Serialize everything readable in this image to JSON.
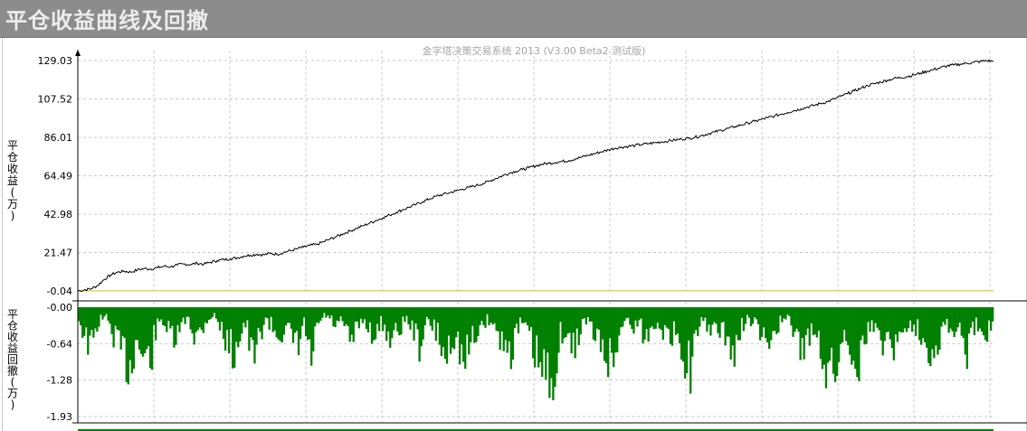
{
  "page_title": "平仓收益曲线及回撤",
  "watermark": "金字塔决策交易系统 2013 (V3.00 Beta2 测试版)",
  "colors": {
    "title_bg": "#8c8c8c",
    "equity_line": "#000000",
    "drawdown_fill": "#008000",
    "baseline": "#d4c200",
    "grid": "#c8c8c8"
  },
  "chart_data": [
    {
      "type": "line",
      "ylabel": "平仓收益(万)",
      "yticks": [
        "129.03",
        "107.52",
        "86.01",
        "64.49",
        "42.98",
        "21.47",
        "-0.04"
      ],
      "ylim": [
        -0.04,
        129.03
      ],
      "grid": true,
      "baseline": 0,
      "series": [
        {
          "values": [
            -0.04,
            0.5,
            1.2,
            3.0,
            6.5,
            9.0,
            10.5,
            11.0,
            10.5,
            11.8,
            12.5,
            12.2,
            13.0,
            13.8,
            13.5,
            14.5,
            15.0,
            14.8,
            15.5,
            15.0,
            16.0,
            17.0,
            17.5,
            18.0,
            18.5,
            19.5,
            20.0,
            20.5,
            20.2,
            21.0,
            20.5,
            21.5,
            22.5,
            23.5,
            24.5,
            25.5,
            26.0,
            27.5,
            29.0,
            30.5,
            32.0,
            33.5,
            35.0,
            36.5,
            38.0,
            39.5,
            41.0,
            42.5,
            44.0,
            45.5,
            47.0,
            48.5,
            50.0,
            51.5,
            53.0,
            54.0,
            55.0,
            56.0,
            57.0,
            58.0,
            59.0,
            60.0,
            61.5,
            63.0,
            64.5,
            66.0,
            67.0,
            68.0,
            69.0,
            70.0,
            71.0,
            71.5,
            72.0,
            72.5,
            73.0,
            74.0,
            75.0,
            76.0,
            77.0,
            78.0,
            79.0,
            80.0,
            80.5,
            81.0,
            81.5,
            82.0,
            82.5,
            83.0,
            83.5,
            84.0,
            84.5,
            85.0,
            85.5,
            86.0,
            87.0,
            88.0,
            89.0,
            90.0,
            91.0,
            92.0,
            93.0,
            94.0,
            95.0,
            96.0,
            97.0,
            98.0,
            99.0,
            100.0,
            101.0,
            102.0,
            103.0,
            104.0,
            105.0,
            106.0,
            107.5,
            109.0,
            110.5,
            112.0,
            113.5,
            115.0,
            116.0,
            117.0,
            118.0,
            119.0,
            119.5,
            120.0,
            121.0,
            122.0,
            123.0,
            124.0,
            125.0,
            126.0,
            126.5,
            127.0,
            127.5,
            128.0,
            128.5,
            129.03,
            128.5
          ]
        }
      ]
    },
    {
      "type": "area",
      "ylabel": "平仓收益回撤(万)",
      "yticks": [
        "-0.00",
        "-0.64",
        "-1.28",
        "-1.93"
      ],
      "ylim": [
        -1.93,
        0
      ],
      "grid": true,
      "series": [
        {
          "values": [
            -0.3,
            -0.8,
            -1.05,
            -0.4,
            -0.2,
            -0.6,
            -0.9,
            -1.3,
            -1.55,
            -0.8,
            -1.3,
            -1.45,
            -0.6,
            -0.3,
            -0.7,
            -0.9,
            -0.5,
            -0.2,
            -0.8,
            -0.6,
            -0.3,
            -0.2,
            -0.5,
            -0.9,
            -1.2,
            -0.7,
            -0.4,
            -1.5,
            -0.8,
            -0.3,
            -0.5,
            -0.7,
            -0.6,
            -0.8,
            -1.1,
            -0.4,
            -1.5,
            -0.6,
            -0.2,
            -0.3,
            -0.5,
            -0.4,
            -0.9,
            -0.7,
            -0.3,
            -0.5,
            -0.8,
            -0.4,
            -0.7,
            -0.8,
            -0.5,
            -0.3,
            -0.6,
            -1.0,
            -0.4,
            -0.5,
            -0.8,
            -1.4,
            -0.7,
            -1.0,
            -1.5,
            -0.9,
            -0.6,
            -0.4,
            -0.3,
            -0.7,
            -0.9,
            -1.2,
            -0.6,
            -0.4,
            -0.8,
            -1.3,
            -1.7,
            -2.0,
            -1.5,
            -0.6,
            -0.9,
            -1.1,
            -0.5,
            -0.3,
            -0.7,
            -1.0,
            -1.2,
            -1.5,
            -0.6,
            -0.3,
            -0.5,
            -0.4,
            -0.8,
            -0.6,
            -0.3,
            -0.7,
            -0.9,
            -0.5,
            -1.2,
            -1.6,
            -0.8,
            -0.4,
            -0.5,
            -0.7,
            -0.6,
            -0.9,
            -1.3,
            -0.5,
            -0.3,
            -0.4,
            -0.8,
            -1.0,
            -0.6,
            -0.4,
            -0.3,
            -0.6,
            -0.9,
            -1.2,
            -0.5,
            -0.8,
            -1.5,
            -1.9,
            -1.3,
            -0.7,
            -1.0,
            -1.6,
            -0.8,
            -0.5,
            -0.6,
            -0.9,
            -0.7,
            -1.1,
            -0.6,
            -0.4,
            -0.5,
            -0.7,
            -1.0,
            -1.2,
            -0.6,
            -0.4,
            -0.8,
            -0.5,
            -1.3,
            -0.6,
            -0.4,
            -0.7,
            -0.3
          ]
        }
      ]
    }
  ]
}
